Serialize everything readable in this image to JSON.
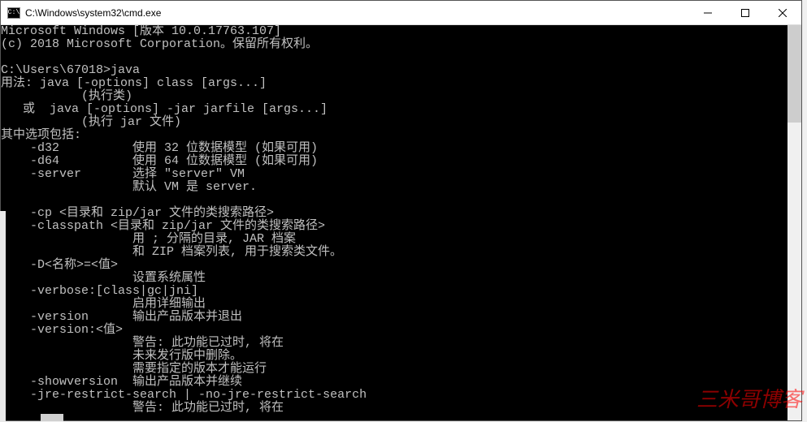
{
  "window": {
    "title": "C:\\Windows\\system32\\cmd.exe",
    "icon_label": "C:\\"
  },
  "terminal": {
    "lines": [
      "Microsoft Windows [版本 10.0.17763.107]",
      "(c) 2018 Microsoft Corporation。保留所有权利。",
      "",
      "C:\\Users\\67018>java",
      "用法: java [-options] class [args...]",
      "           (执行类)",
      "   或  java [-options] -jar jarfile [args...]",
      "           (执行 jar 文件)",
      "其中选项包括:",
      "    -d32          使用 32 位数据模型 (如果可用)",
      "    -d64          使用 64 位数据模型 (如果可用)",
      "    -server       选择 \"server\" VM",
      "                  默认 VM 是 server.",
      "",
      "    -cp <目录和 zip/jar 文件的类搜索路径>",
      "    -classpath <目录和 zip/jar 文件的类搜索路径>",
      "                  用 ; 分隔的目录, JAR 档案",
      "                  和 ZIP 档案列表, 用于搜索类文件。",
      "    -D<名称>=<值>",
      "                  设置系统属性",
      "    -verbose:[class|gc|jni]",
      "                  启用详细输出",
      "    -version      输出产品版本并退出",
      "    -version:<值>",
      "                  警告: 此功能已过时, 将在",
      "                  未来发行版中删除。",
      "                  需要指定的版本才能运行",
      "    -showversion  输出产品版本并继续",
      "    -jre-restrict-search | -no-jre-restrict-search",
      "                  警告: 此功能已过时, 将在"
    ]
  },
  "watermark": "三米哥博客"
}
